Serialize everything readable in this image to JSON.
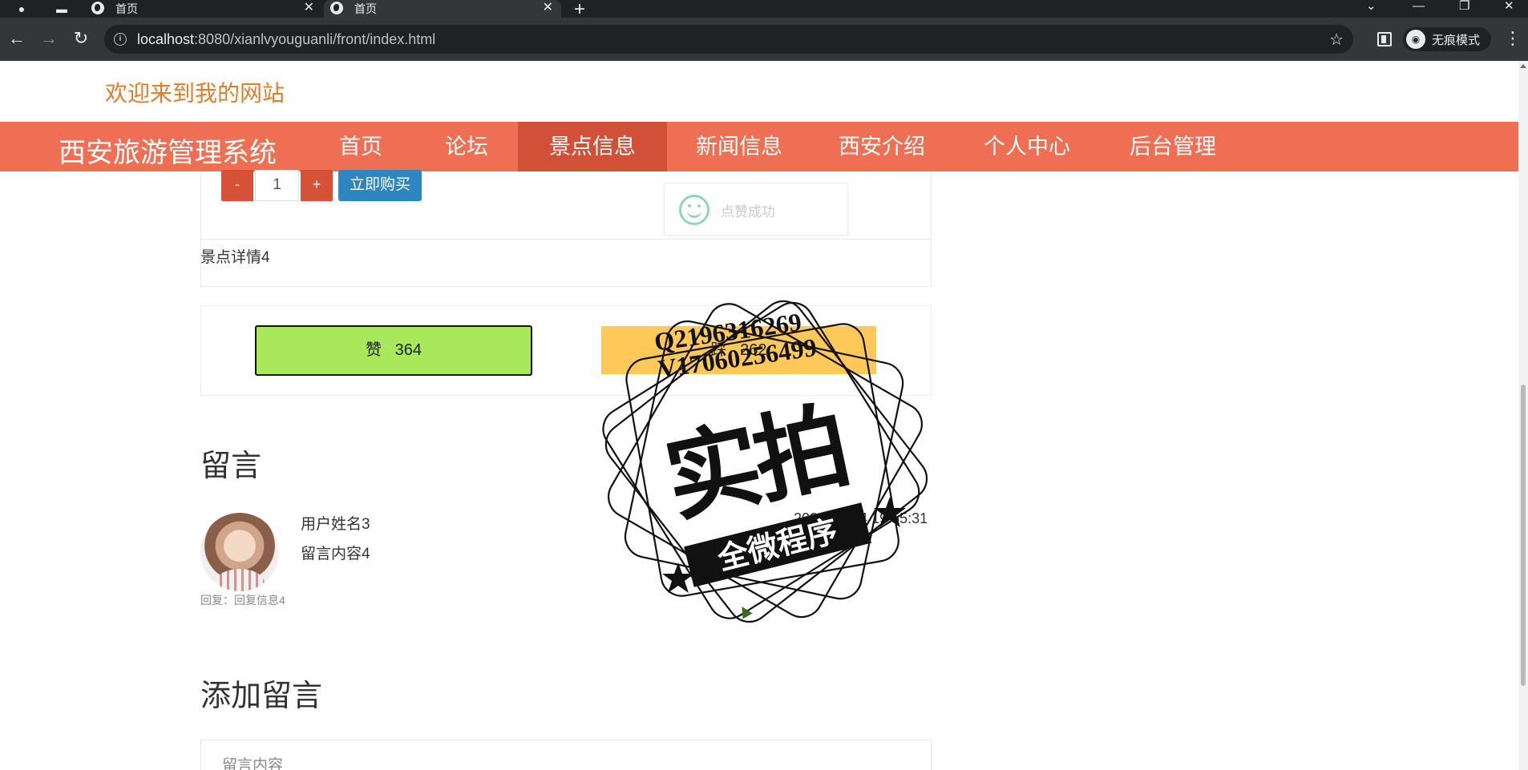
{
  "browser": {
    "tabs": [
      {
        "title": "首页",
        "active": false
      },
      {
        "title": "首页",
        "active": true
      }
    ],
    "url_host": "localhost",
    "url_path": ":8080/xianlvyouguanli/front/index.html",
    "incognito_label": "无痕模式"
  },
  "site": {
    "welcome": "欢迎来到我的网站",
    "brand": "西安旅游管理系统",
    "nav": [
      {
        "label": "首页",
        "active": false
      },
      {
        "label": "论坛",
        "active": false
      },
      {
        "label": "景点信息",
        "active": true
      },
      {
        "label": "新闻信息",
        "active": false
      },
      {
        "label": "西安介绍",
        "active": false
      },
      {
        "label": "个人中心",
        "active": false
      },
      {
        "label": "后台管理",
        "active": false
      }
    ]
  },
  "purchase": {
    "minus": "-",
    "quantity": "1",
    "plus": "+",
    "buy_label": "立即购买"
  },
  "toast": {
    "message": "点赞成功"
  },
  "detail": {
    "text": "景点详情4"
  },
  "votes": {
    "like_label": "赞",
    "like_count": "364",
    "dislike_label": "踩",
    "dislike_count": "262"
  },
  "comments": {
    "title": "留言",
    "items": [
      {
        "user": "用户姓名3",
        "content": "留言内容4",
        "date": "2022-05-04 19:55:31",
        "reply": "回复：回复信息4"
      }
    ]
  },
  "add_comment": {
    "title": "添加留言",
    "placeholder": "留言内容"
  },
  "watermark": {
    "line1": "Q2196316269",
    "line2": "V17060256499",
    "big": "实拍",
    "ribbon": "全微程序"
  },
  "colors": {
    "nav_bg": "#ee6f53",
    "nav_active": "#d05038",
    "welcome": "#e27d2c",
    "like_bg": "#a9e85b",
    "dislike_bg": "#ffc95a",
    "buy_bg": "#2d86c0"
  }
}
